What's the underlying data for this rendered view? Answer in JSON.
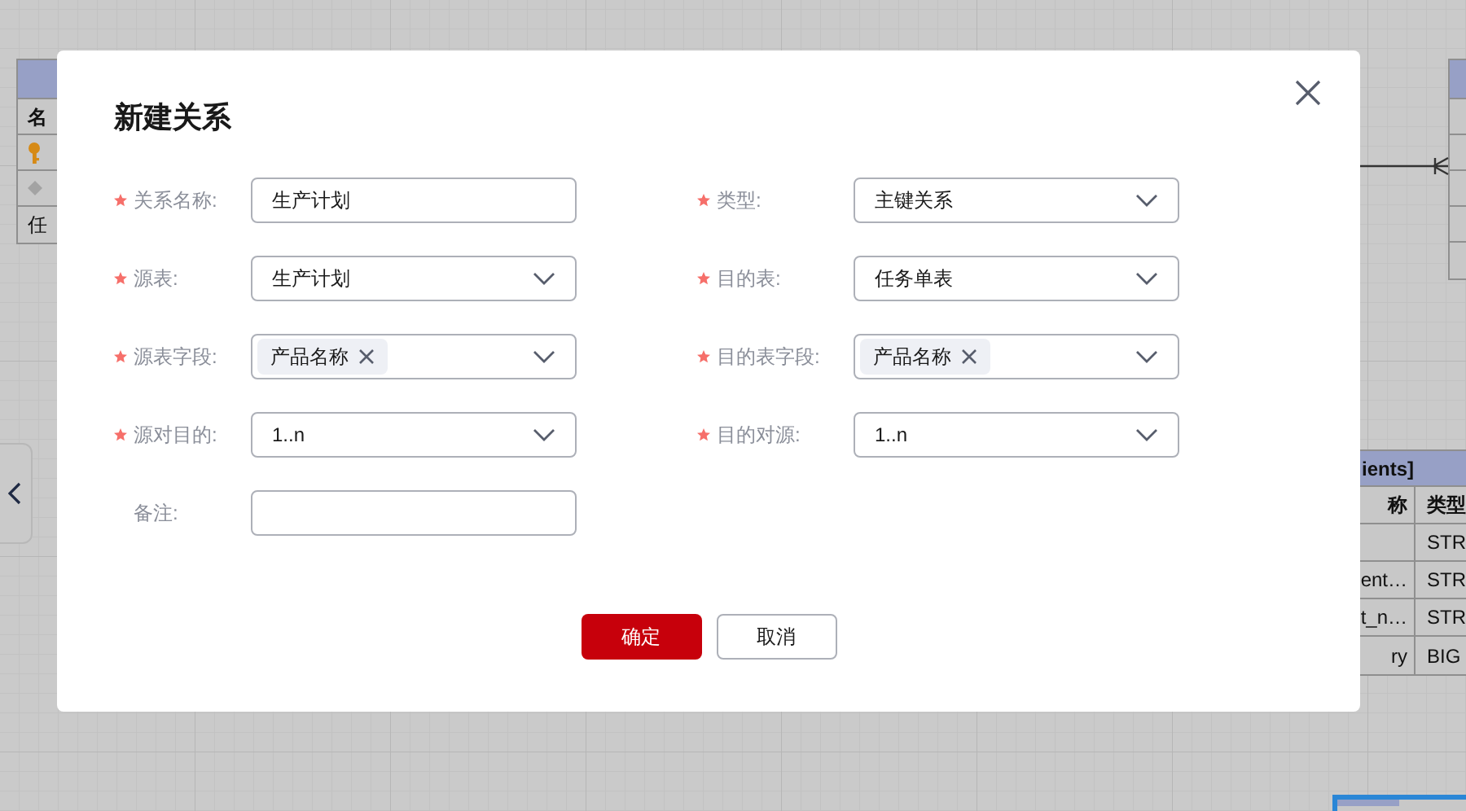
{
  "canvas": {
    "left_table": {
      "rows": [
        {
          "kind": "text",
          "text": "名"
        },
        {
          "kind": "key"
        },
        {
          "kind": "diamond"
        },
        {
          "kind": "text",
          "text": "任"
        }
      ]
    },
    "right_table": {
      "title": "ients]",
      "rows": [
        {
          "column_1": "称",
          "column_2": "类型"
        },
        {
          "column_2": "STR"
        },
        {
          "column_1": "ent…",
          "column_2": "STR"
        },
        {
          "column_1": "t_n…",
          "column_2": "STR"
        },
        {
          "column_1": "ry",
          "column_2": "BIG"
        }
      ]
    }
  },
  "dialog": {
    "title": "新建关系",
    "fields": [
      {
        "label": "关系名称:",
        "required": true,
        "kind": "input",
        "value": "生产计划"
      },
      {
        "label": "类型:",
        "required": true,
        "kind": "select",
        "value": "主键关系"
      },
      {
        "label": "源表:",
        "required": true,
        "kind": "select",
        "value": "生产计划"
      },
      {
        "label": "目的表:",
        "required": true,
        "kind": "select",
        "value": "任务单表"
      },
      {
        "label": "源表字段:",
        "required": true,
        "kind": "tags",
        "tags": [
          "产品名称"
        ]
      },
      {
        "label": "目的表字段:",
        "required": true,
        "kind": "tags",
        "tags": [
          "产品名称"
        ]
      },
      {
        "label": "源对目的:",
        "required": true,
        "kind": "select",
        "value": "1..n"
      },
      {
        "label": "目的对源:",
        "required": true,
        "kind": "select",
        "value": "1..n"
      },
      {
        "label": "备注:",
        "required": false,
        "kind": "input"
      }
    ],
    "buttons": [
      {
        "label": "确定",
        "kind": "primary"
      },
      {
        "label": "取消",
        "kind": "secondary"
      }
    ]
  }
}
